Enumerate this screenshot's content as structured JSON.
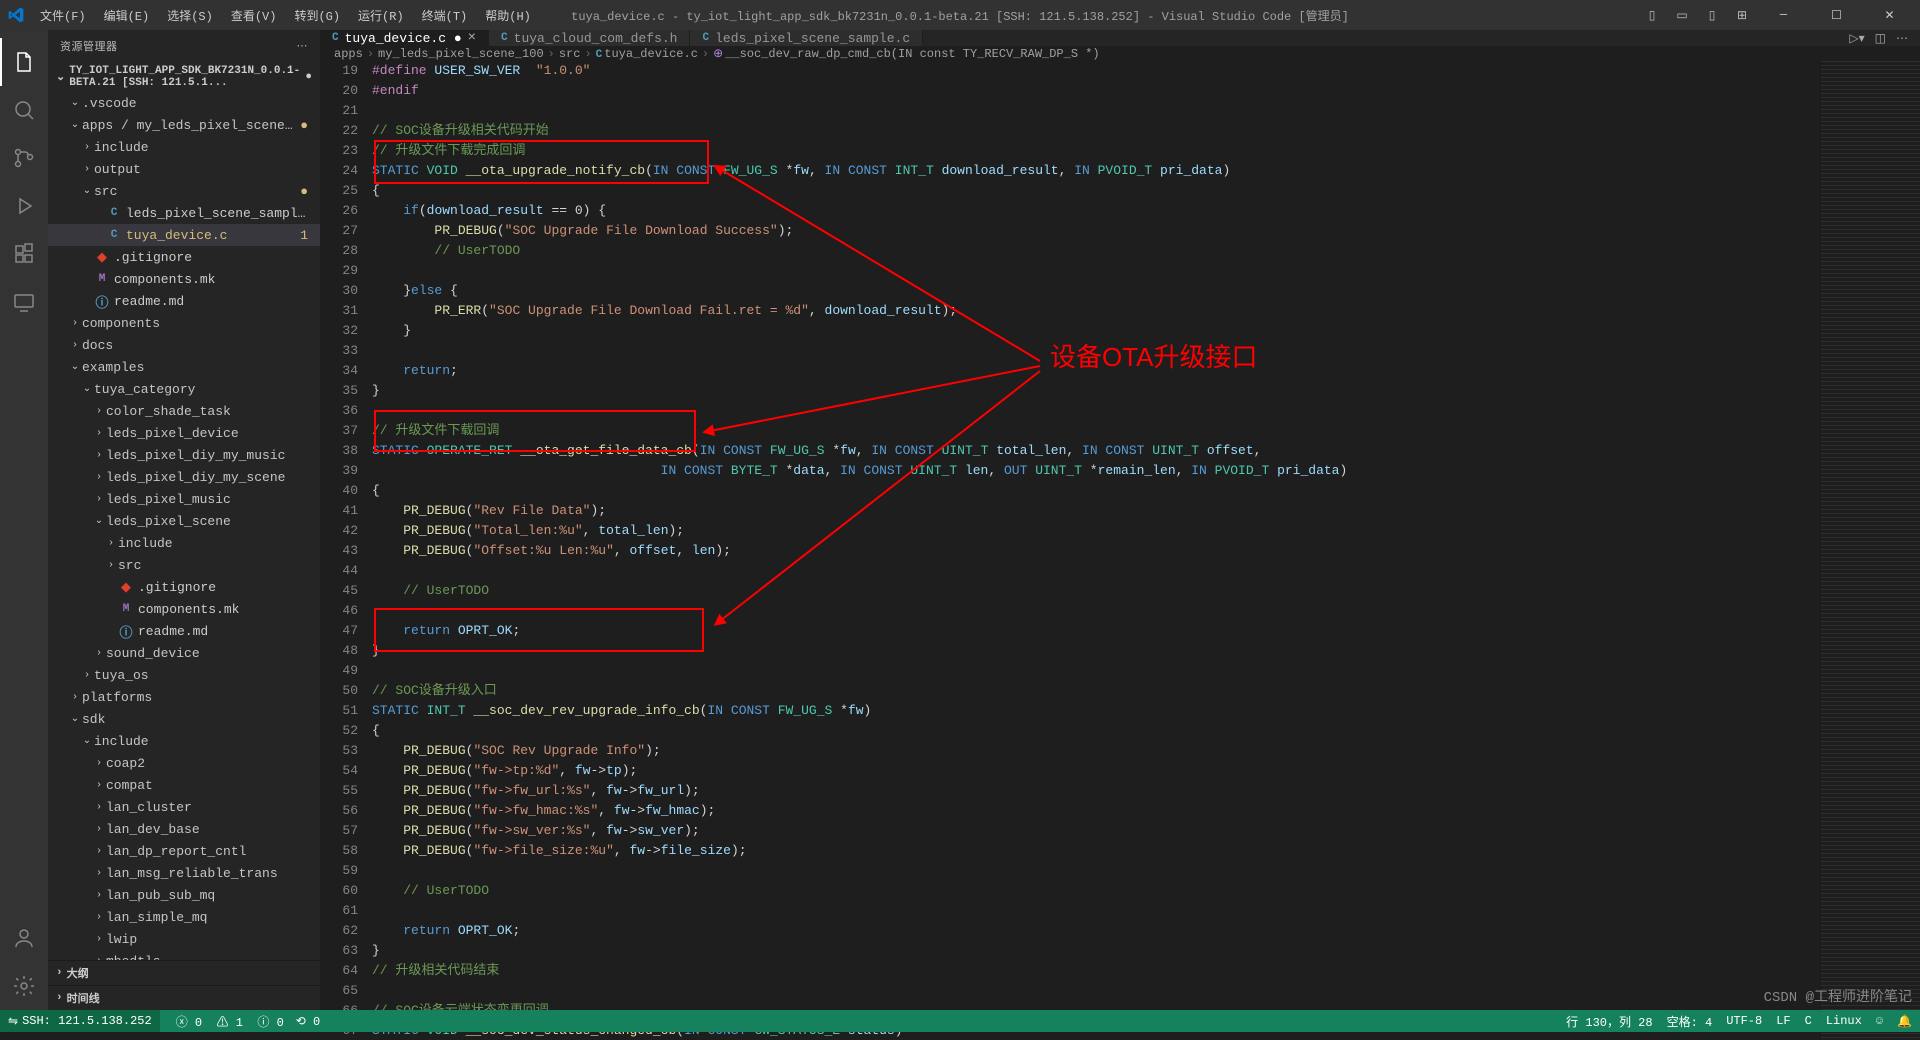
{
  "title": "tuya_device.c - ty_iot_light_app_sdk_bk7231n_0.0.1-beta.21 [SSH: 121.5.138.252] - Visual Studio Code [管理员]",
  "menu": {
    "file": "文件(F)",
    "edit": "编辑(E)",
    "select": "选择(S)",
    "view": "查看(V)",
    "go": "转到(G)",
    "run": "运行(R)",
    "terminal": "终端(T)",
    "help": "帮助(H)"
  },
  "sidebar": {
    "title": "资源管理器",
    "project": "TY_IOT_LIGHT_APP_SDK_BK7231N_0.0.1-BETA.21 [SSH: 121.5.1...",
    "tree": [
      {
        "d": 1,
        "t": "folder",
        "open": true,
        "label": ".vscode"
      },
      {
        "d": 1,
        "t": "folder",
        "open": true,
        "label": "apps / my_leds_pixel_scene_100",
        "mod": true
      },
      {
        "d": 2,
        "t": "folder",
        "open": false,
        "label": "include"
      },
      {
        "d": 2,
        "t": "folder",
        "open": false,
        "label": "output"
      },
      {
        "d": 2,
        "t": "folder",
        "open": true,
        "label": "src",
        "mod": true
      },
      {
        "d": 3,
        "t": "c",
        "label": "leds_pixel_scene_sample.c"
      },
      {
        "d": 3,
        "t": "c",
        "label": "tuya_device.c",
        "mod": true,
        "sel": true,
        "num": "1"
      },
      {
        "d": 2,
        "t": "git",
        "label": ".gitignore"
      },
      {
        "d": 2,
        "t": "m",
        "label": "components.mk"
      },
      {
        "d": 2,
        "t": "i",
        "label": "readme.md"
      },
      {
        "d": 1,
        "t": "folder",
        "open": false,
        "label": "components"
      },
      {
        "d": 1,
        "t": "folder",
        "open": false,
        "label": "docs"
      },
      {
        "d": 1,
        "t": "folder",
        "open": true,
        "label": "examples"
      },
      {
        "d": 2,
        "t": "folder",
        "open": true,
        "label": "tuya_category"
      },
      {
        "d": 3,
        "t": "folder",
        "open": false,
        "label": "color_shade_task"
      },
      {
        "d": 3,
        "t": "folder",
        "open": false,
        "label": "leds_pixel_device"
      },
      {
        "d": 3,
        "t": "folder",
        "open": false,
        "label": "leds_pixel_diy_my_music"
      },
      {
        "d": 3,
        "t": "folder",
        "open": false,
        "label": "leds_pixel_diy_my_scene"
      },
      {
        "d": 3,
        "t": "folder",
        "open": false,
        "label": "leds_pixel_music"
      },
      {
        "d": 3,
        "t": "folder",
        "open": true,
        "label": "leds_pixel_scene"
      },
      {
        "d": 4,
        "t": "folder",
        "open": false,
        "label": "include"
      },
      {
        "d": 4,
        "t": "folder",
        "open": false,
        "label": "src"
      },
      {
        "d": 4,
        "t": "git",
        "label": ".gitignore"
      },
      {
        "d": 4,
        "t": "m",
        "label": "components.mk"
      },
      {
        "d": 4,
        "t": "i",
        "label": "readme.md"
      },
      {
        "d": 3,
        "t": "folder",
        "open": false,
        "label": "sound_device"
      },
      {
        "d": 2,
        "t": "folder",
        "open": false,
        "label": "tuya_os"
      },
      {
        "d": 1,
        "t": "folder",
        "open": false,
        "label": "platforms"
      },
      {
        "d": 1,
        "t": "folder",
        "open": true,
        "label": "sdk"
      },
      {
        "d": 2,
        "t": "folder",
        "open": true,
        "label": "include"
      },
      {
        "d": 3,
        "t": "folder",
        "open": false,
        "label": "coap2"
      },
      {
        "d": 3,
        "t": "folder",
        "open": false,
        "label": "compat"
      },
      {
        "d": 3,
        "t": "folder",
        "open": false,
        "label": "lan_cluster"
      },
      {
        "d": 3,
        "t": "folder",
        "open": false,
        "label": "lan_dev_base"
      },
      {
        "d": 3,
        "t": "folder",
        "open": false,
        "label": "lan_dp_report_cntl"
      },
      {
        "d": 3,
        "t": "folder",
        "open": false,
        "label": "lan_msg_reliable_trans"
      },
      {
        "d": 3,
        "t": "folder",
        "open": false,
        "label": "lan_pub_sub_mq"
      },
      {
        "d": 3,
        "t": "folder",
        "open": false,
        "label": "lan_simple_mq"
      },
      {
        "d": 3,
        "t": "folder",
        "open": false,
        "label": "lwip"
      },
      {
        "d": 3,
        "t": "folder",
        "open": false,
        "label": "mbedtls"
      }
    ],
    "outline": "大纲",
    "timeline": "时间线"
  },
  "tabs": [
    {
      "icon": "c",
      "label": "tuya_device.c",
      "mod": true,
      "active": true
    },
    {
      "icon": "c",
      "label": "tuya_cloud_com_defs.h"
    },
    {
      "icon": "c",
      "label": "leds_pixel_scene_sample.c"
    }
  ],
  "breadcrumb": [
    "apps",
    "my_leds_pixel_scene_100",
    "src",
    "tuya_device.c",
    "__soc_dev_raw_dp_cmd_cb(IN const TY_RECV_RAW_DP_S *)"
  ],
  "code": {
    "start": 19,
    "lines": [
      [
        {
          "c": "mc",
          "t": "#define "
        },
        {
          "c": "pm",
          "t": "USER_SW_VER  "
        },
        {
          "c": "str",
          "t": "\"1.0.0\""
        }
      ],
      [
        {
          "c": "mc",
          "t": "#endif"
        }
      ],
      [],
      [
        {
          "c": "cm",
          "t": "// SOC设备升级相关代码开始"
        }
      ],
      [
        {
          "c": "cm",
          "t": "// 升级文件下载完成回调"
        }
      ],
      [
        {
          "c": "kw",
          "t": "STATIC "
        },
        {
          "c": "ty",
          "t": "VOID "
        },
        {
          "c": "fn",
          "t": "__ota_upgrade_notify_cb"
        },
        {
          "c": "op",
          "t": "("
        },
        {
          "c": "kw",
          "t": "IN CONST "
        },
        {
          "c": "ty",
          "t": "FW_UG_S "
        },
        {
          "c": "op",
          "t": "*"
        },
        {
          "c": "pm",
          "t": "fw"
        },
        {
          "c": "op",
          "t": ", "
        },
        {
          "c": "kw",
          "t": "IN CONST "
        },
        {
          "c": "ty",
          "t": "INT_T "
        },
        {
          "c": "pm",
          "t": "download_result"
        },
        {
          "c": "op",
          "t": ", "
        },
        {
          "c": "kw",
          "t": "IN "
        },
        {
          "c": "ty",
          "t": "PVOID_T "
        },
        {
          "c": "pm",
          "t": "pri_data"
        },
        {
          "c": "op",
          "t": ")"
        }
      ],
      [
        {
          "c": "op",
          "t": "{"
        }
      ],
      [
        {
          "c": "op",
          "t": "    "
        },
        {
          "c": "kw",
          "t": "if"
        },
        {
          "c": "op",
          "t": "("
        },
        {
          "c": "pm",
          "t": "download_result"
        },
        {
          "c": "op",
          "t": " == 0) {"
        }
      ],
      [
        {
          "c": "op",
          "t": "        "
        },
        {
          "c": "fn",
          "t": "PR_DEBUG"
        },
        {
          "c": "op",
          "t": "("
        },
        {
          "c": "str",
          "t": "\"SOC Upgrade File Download Success\""
        },
        {
          "c": "op",
          "t": ");"
        }
      ],
      [
        {
          "c": "op",
          "t": "        "
        },
        {
          "c": "cm",
          "t": "// UserTODO"
        }
      ],
      [],
      [
        {
          "c": "op",
          "t": "    }"
        },
        {
          "c": "kw",
          "t": "else "
        },
        {
          "c": "op",
          "t": "{"
        }
      ],
      [
        {
          "c": "op",
          "t": "        "
        },
        {
          "c": "fn",
          "t": "PR_ERR"
        },
        {
          "c": "op",
          "t": "("
        },
        {
          "c": "str",
          "t": "\"SOC Upgrade File Download Fail.ret = %d\""
        },
        {
          "c": "op",
          "t": ", "
        },
        {
          "c": "pm",
          "t": "download_result"
        },
        {
          "c": "op",
          "t": ");"
        }
      ],
      [
        {
          "c": "op",
          "t": "    }"
        }
      ],
      [],
      [
        {
          "c": "op",
          "t": "    "
        },
        {
          "c": "kw",
          "t": "return"
        },
        {
          "c": "op",
          "t": ";"
        }
      ],
      [
        {
          "c": "op",
          "t": "}"
        }
      ],
      [],
      [
        {
          "c": "cm",
          "t": "// 升级文件下载回调"
        }
      ],
      [
        {
          "c": "kw",
          "t": "STATIC "
        },
        {
          "c": "ty",
          "t": "OPERATE_RET "
        },
        {
          "c": "fn",
          "t": "__ota_get_file_data_cb"
        },
        {
          "c": "op",
          "t": "("
        },
        {
          "c": "kw",
          "t": "IN CONST "
        },
        {
          "c": "ty",
          "t": "FW_UG_S "
        },
        {
          "c": "op",
          "t": "*"
        },
        {
          "c": "pm",
          "t": "fw"
        },
        {
          "c": "op",
          "t": ", "
        },
        {
          "c": "kw",
          "t": "IN CONST "
        },
        {
          "c": "ty",
          "t": "UINT_T "
        },
        {
          "c": "pm",
          "t": "total_len"
        },
        {
          "c": "op",
          "t": ", "
        },
        {
          "c": "kw",
          "t": "IN CONST "
        },
        {
          "c": "ty",
          "t": "UINT_T "
        },
        {
          "c": "pm",
          "t": "offset"
        },
        {
          "c": "op",
          "t": ","
        }
      ],
      [
        {
          "c": "op",
          "t": "                                     "
        },
        {
          "c": "kw",
          "t": "IN CONST "
        },
        {
          "c": "ty",
          "t": "BYTE_T "
        },
        {
          "c": "op",
          "t": "*"
        },
        {
          "c": "pm",
          "t": "data"
        },
        {
          "c": "op",
          "t": ", "
        },
        {
          "c": "kw",
          "t": "IN CONST "
        },
        {
          "c": "ty",
          "t": "UINT_T "
        },
        {
          "c": "pm",
          "t": "len"
        },
        {
          "c": "op",
          "t": ", "
        },
        {
          "c": "kw",
          "t": "OUT "
        },
        {
          "c": "ty",
          "t": "UINT_T "
        },
        {
          "c": "op",
          "t": "*"
        },
        {
          "c": "pm",
          "t": "remain_len"
        },
        {
          "c": "op",
          "t": ", "
        },
        {
          "c": "kw",
          "t": "IN "
        },
        {
          "c": "ty",
          "t": "PVOID_T "
        },
        {
          "c": "pm",
          "t": "pri_data"
        },
        {
          "c": "op",
          "t": ")"
        }
      ],
      [
        {
          "c": "op",
          "t": "{"
        }
      ],
      [
        {
          "c": "op",
          "t": "    "
        },
        {
          "c": "fn",
          "t": "PR_DEBUG"
        },
        {
          "c": "op",
          "t": "("
        },
        {
          "c": "str",
          "t": "\"Rev File Data\""
        },
        {
          "c": "op",
          "t": ");"
        }
      ],
      [
        {
          "c": "op",
          "t": "    "
        },
        {
          "c": "fn",
          "t": "PR_DEBUG"
        },
        {
          "c": "op",
          "t": "("
        },
        {
          "c": "str",
          "t": "\"Total_len:%u\""
        },
        {
          "c": "op",
          "t": ", "
        },
        {
          "c": "pm",
          "t": "total_len"
        },
        {
          "c": "op",
          "t": ");"
        }
      ],
      [
        {
          "c": "op",
          "t": "    "
        },
        {
          "c": "fn",
          "t": "PR_DEBUG"
        },
        {
          "c": "op",
          "t": "("
        },
        {
          "c": "str",
          "t": "\"Offset:%u Len:%u\""
        },
        {
          "c": "op",
          "t": ", "
        },
        {
          "c": "pm",
          "t": "offset"
        },
        {
          "c": "op",
          "t": ", "
        },
        {
          "c": "pm",
          "t": "len"
        },
        {
          "c": "op",
          "t": ");"
        }
      ],
      [],
      [
        {
          "c": "op",
          "t": "    "
        },
        {
          "c": "cm",
          "t": "// UserTODO"
        }
      ],
      [],
      [
        {
          "c": "op",
          "t": "    "
        },
        {
          "c": "kw",
          "t": "return "
        },
        {
          "c": "pm",
          "t": "OPRT_OK"
        },
        {
          "c": "op",
          "t": ";"
        }
      ],
      [
        {
          "c": "op",
          "t": "}"
        }
      ],
      [],
      [
        {
          "c": "cm",
          "t": "// SOC设备升级入口"
        }
      ],
      [
        {
          "c": "kw",
          "t": "STATIC "
        },
        {
          "c": "ty",
          "t": "INT_T "
        },
        {
          "c": "fn",
          "t": "__soc_dev_rev_upgrade_info_cb"
        },
        {
          "c": "op",
          "t": "("
        },
        {
          "c": "kw",
          "t": "IN CONST "
        },
        {
          "c": "ty",
          "t": "FW_UG_S "
        },
        {
          "c": "op",
          "t": "*"
        },
        {
          "c": "pm",
          "t": "fw"
        },
        {
          "c": "op",
          "t": ")"
        }
      ],
      [
        {
          "c": "op",
          "t": "{"
        }
      ],
      [
        {
          "c": "op",
          "t": "    "
        },
        {
          "c": "fn",
          "t": "PR_DEBUG"
        },
        {
          "c": "op",
          "t": "("
        },
        {
          "c": "str",
          "t": "\"SOC Rev Upgrade Info\""
        },
        {
          "c": "op",
          "t": ");"
        }
      ],
      [
        {
          "c": "op",
          "t": "    "
        },
        {
          "c": "fn",
          "t": "PR_DEBUG"
        },
        {
          "c": "op",
          "t": "("
        },
        {
          "c": "str",
          "t": "\"fw->tp:%d\""
        },
        {
          "c": "op",
          "t": ", "
        },
        {
          "c": "pm",
          "t": "fw"
        },
        {
          "c": "op",
          "t": "->"
        },
        {
          "c": "pm",
          "t": "tp"
        },
        {
          "c": "op",
          "t": ");"
        }
      ],
      [
        {
          "c": "op",
          "t": "    "
        },
        {
          "c": "fn",
          "t": "PR_DEBUG"
        },
        {
          "c": "op",
          "t": "("
        },
        {
          "c": "str",
          "t": "\"fw->fw_url:%s\""
        },
        {
          "c": "op",
          "t": ", "
        },
        {
          "c": "pm",
          "t": "fw"
        },
        {
          "c": "op",
          "t": "->"
        },
        {
          "c": "pm",
          "t": "fw_url"
        },
        {
          "c": "op",
          "t": ");"
        }
      ],
      [
        {
          "c": "op",
          "t": "    "
        },
        {
          "c": "fn",
          "t": "PR_DEBUG"
        },
        {
          "c": "op",
          "t": "("
        },
        {
          "c": "str",
          "t": "\"fw->fw_hmac:%s\""
        },
        {
          "c": "op",
          "t": ", "
        },
        {
          "c": "pm",
          "t": "fw"
        },
        {
          "c": "op",
          "t": "->"
        },
        {
          "c": "pm",
          "t": "fw_hmac"
        },
        {
          "c": "op",
          "t": ");"
        }
      ],
      [
        {
          "c": "op",
          "t": "    "
        },
        {
          "c": "fn",
          "t": "PR_DEBUG"
        },
        {
          "c": "op",
          "t": "("
        },
        {
          "c": "str",
          "t": "\"fw->sw_ver:%s\""
        },
        {
          "c": "op",
          "t": ", "
        },
        {
          "c": "pm",
          "t": "fw"
        },
        {
          "c": "op",
          "t": "->"
        },
        {
          "c": "pm",
          "t": "sw_ver"
        },
        {
          "c": "op",
          "t": ");"
        }
      ],
      [
        {
          "c": "op",
          "t": "    "
        },
        {
          "c": "fn",
          "t": "PR_DEBUG"
        },
        {
          "c": "op",
          "t": "("
        },
        {
          "c": "str",
          "t": "\"fw->file_size:%u\""
        },
        {
          "c": "op",
          "t": ", "
        },
        {
          "c": "pm",
          "t": "fw"
        },
        {
          "c": "op",
          "t": "->"
        },
        {
          "c": "pm",
          "t": "file_size"
        },
        {
          "c": "op",
          "t": ");"
        }
      ],
      [],
      [
        {
          "c": "op",
          "t": "    "
        },
        {
          "c": "cm",
          "t": "// UserTODO"
        }
      ],
      [],
      [
        {
          "c": "op",
          "t": "    "
        },
        {
          "c": "kw",
          "t": "return "
        },
        {
          "c": "pm",
          "t": "OPRT_OK"
        },
        {
          "c": "op",
          "t": ";"
        }
      ],
      [
        {
          "c": "op",
          "t": "}"
        }
      ],
      [
        {
          "c": "cm",
          "t": "// 升级相关代码结束"
        }
      ],
      [],
      [
        {
          "c": "cm",
          "t": "// SOC设备云端状态变更回调"
        }
      ],
      [
        {
          "c": "kw",
          "t": "STATIC "
        },
        {
          "c": "ty",
          "t": "VOID "
        },
        {
          "c": "fn",
          "t": "__soc_dev_status_changed_cb"
        },
        {
          "c": "op",
          "t": "("
        },
        {
          "c": "kw",
          "t": "IN CONST "
        },
        {
          "c": "ty",
          "t": "GW_STATUS_E "
        },
        {
          "c": "pm",
          "t": "status"
        },
        {
          "c": "op",
          "t": ")"
        }
      ]
    ]
  },
  "annotation_label": "设备OTA升级接口",
  "status": {
    "remote": "SSH: 121.5.138.252",
    "errors": "0",
    "warnings": "1",
    "infos": "0",
    "ports": "0",
    "cursor": "行 130，列 28",
    "spaces": "空格: 4",
    "encoding": "UTF-8",
    "eol": "LF",
    "lang": "C",
    "os": "Linux",
    "bell": "🔔"
  },
  "watermark": "CSDN @工程师进阶笔记"
}
